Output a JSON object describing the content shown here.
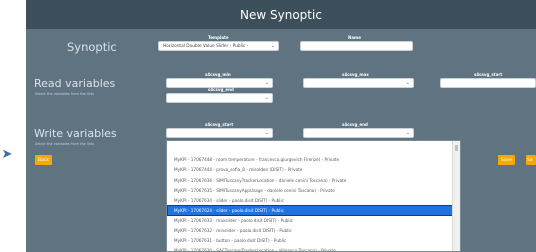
{
  "title": "New Synoptic",
  "synoptic": {
    "heading": "Synoptic",
    "template_label": "Template",
    "template_value": "Horizontal Double Value Slider - Public -",
    "name_label": "Name",
    "name_value": ""
  },
  "read": {
    "heading": "Read variables",
    "subtitle": "Select the variables from the lists",
    "labels": [
      "s4csvg_min",
      "s4csvg_max",
      "s4csvg_start",
      "s4csvg_end"
    ]
  },
  "write": {
    "heading": "Write variables",
    "subtitle": "Select the variables from the lists",
    "labels": [
      "s4csvg_start",
      "s4csvg_end"
    ]
  },
  "buttons": {
    "back": "Back",
    "save": "Save",
    "partial": "Sa"
  },
  "dropdown": {
    "selected_index": 5,
    "items": [
      "MyKPI - 17067448 - room temperature - francesco.giurgevich Firenze) - Private",
      "MyKPI - 17067444 - prova_sofia_8 - misolden (DISIT) - Private",
      "MyKPI - 17067636 - SIMITuscanyTrackerLocation - daniele cenini Toscana) - Private",
      "MyKPI - 17067635 - SIMITuscanyAppUsage - daniele cenini Toscana) - Private",
      "MyKPI - 17067634 - slider - paolo.disit DISIT) - Public",
      "MyKPI - 17067624 - slider - paolo.disit DISIT) - Public",
      "MyKPI - 17067633 - maxslider - paolo.disit DISIT) - Public",
      "MyKPI - 17067632 - minslider - paolo.disit DISIT) - Public",
      "MyKPI - 17067631 - button - paolo.disit DISIT) - Public",
      "MyKPI - 17067630 - SACTuscanyTrackerLocation - alibianco Toscana) - Private"
    ]
  },
  "colors": {
    "background": "#5f7380",
    "titlebar": "#3d4f5b",
    "accent": "#f2a900",
    "selection": "#1e73e0"
  }
}
